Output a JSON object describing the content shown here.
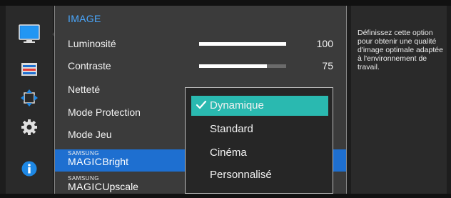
{
  "menu": {
    "title": "IMAGE",
    "items": [
      {
        "label": "Luminosité",
        "value": "100",
        "level": 1.0
      },
      {
        "label": "Contraste",
        "value": "75",
        "level": 0.78
      },
      {
        "label": "Netteté"
      },
      {
        "label": "Mode Protection"
      },
      {
        "label": "Mode Jeu"
      },
      {
        "brand": "SAMSUNG",
        "word": "MAGIC",
        "label": "Bright",
        "selected": true
      },
      {
        "brand": "SAMSUNG",
        "word": "MAGIC",
        "label": "Upscale"
      }
    ]
  },
  "dropdown": {
    "options": [
      {
        "label": "Dynamique",
        "selected": true
      },
      {
        "label": "Standard"
      },
      {
        "label": "Cinéma"
      },
      {
        "label": "Personnalisé"
      }
    ]
  },
  "sidebar": {
    "icons": [
      "monitor-icon",
      "picture-settings-icon",
      "resize-arrows-icon",
      "gear-icon",
      "info-icon"
    ],
    "active_index": 0
  },
  "help": {
    "text": "Définissez cette option pour obtenir une qualité d'image optimale adaptée à l'environnement de travail."
  },
  "colors": {
    "accent_blue": "#1e6fd0",
    "title_blue": "#4aa8ff",
    "dropdown_active": "#2ab9b0"
  }
}
